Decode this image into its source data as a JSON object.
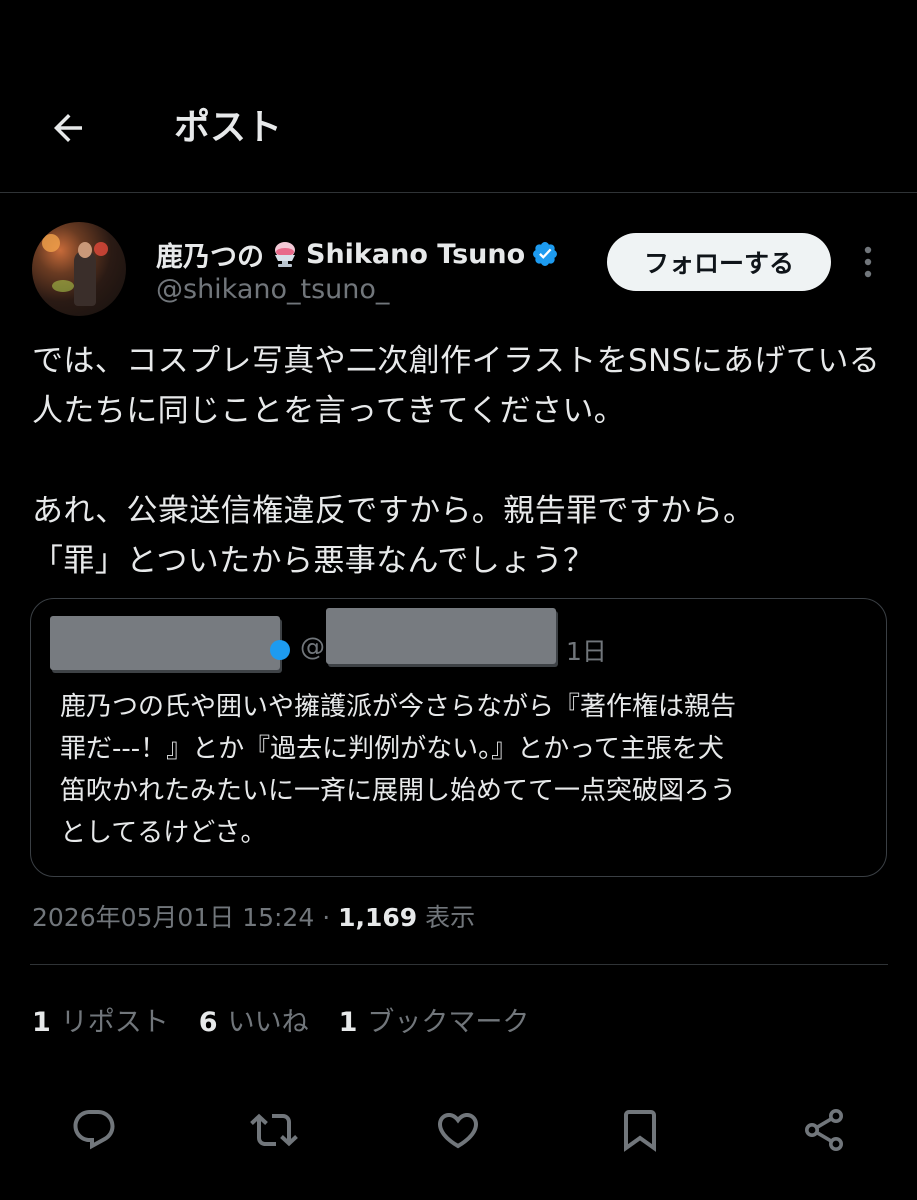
{
  "header": {
    "title": "ポスト"
  },
  "author": {
    "display_name": "鹿乃つの",
    "display_name_suffix": "Shikano Tsuno",
    "handle": "@shikano_tsuno_",
    "verified_color": "#1d9bf0"
  },
  "follow_button": {
    "label": "フォローする"
  },
  "tweet": {
    "text": "では、コスプレ写真や二次創作イラストをSNSにあげている人たちに同じことを言ってきてください。\n\nあれ、公衆送信権違反ですから。親告罪ですから。\n「罪」とついたから悪事なんでしょう？"
  },
  "quote": {
    "at_prefix": "@",
    "time": "1日",
    "text": "鹿乃つの氏や囲いや擁護派が今さらながら『著作権は親告\n罪だ---！』とか『過去に判例がない。』とかって主張を犬\n笛吹かれたみたいに一斉に展開し始めてて一点突破図ろう\nとしてるけどさ。"
  },
  "meta": {
    "timestamp": "2026年05月01日 15:24",
    "separator": " · ",
    "views_count": "1,169",
    "views_label": " 表示"
  },
  "stats": {
    "reposts_count": "1",
    "reposts_label": "リポスト",
    "likes_count": "6",
    "likes_label": "いいね",
    "bookmarks_count": "1",
    "bookmarks_label": "ブックマーク"
  },
  "colors": {
    "background": "#000000",
    "text_primary": "#e7e9ea",
    "text_secondary": "#71767b",
    "divider": "#2f3336",
    "accent": "#1d9bf0"
  }
}
